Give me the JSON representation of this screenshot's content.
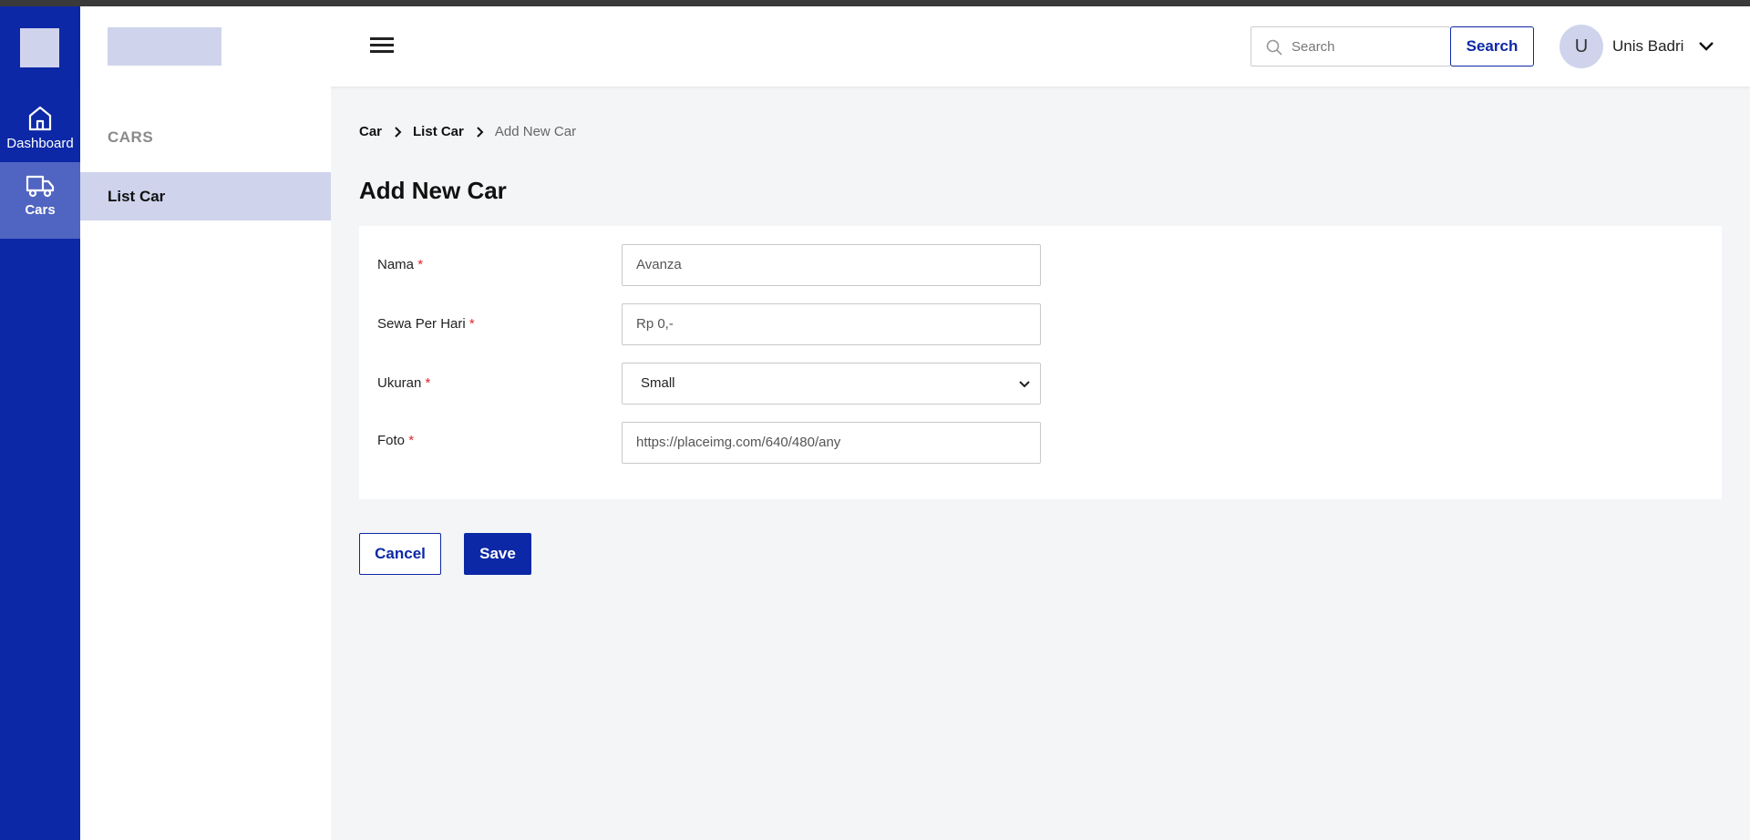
{
  "rail": {
    "items": [
      {
        "label": "Dashboard",
        "icon": "home-icon"
      },
      {
        "label": "Cars",
        "icon": "truck-icon",
        "active": true
      }
    ]
  },
  "header": {
    "search_placeholder": "Search",
    "search_button": "Search",
    "avatar_initial": "U",
    "user_name": "Unis Badri"
  },
  "subnav": {
    "title": "CARS",
    "items": [
      {
        "label": "List Car",
        "active": true
      }
    ]
  },
  "breadcrumb": {
    "items": [
      "Car",
      "List Car"
    ],
    "current": "Add New Car"
  },
  "page_title": "Add New Car",
  "form": {
    "fields": [
      {
        "label": "Nama",
        "required": "*",
        "placeholder": "Avanza"
      },
      {
        "label": "Sewa Per Hari",
        "required": "*",
        "placeholder": "Rp 0,-"
      },
      {
        "label": "Ukuran",
        "required": "*",
        "value": "Small"
      },
      {
        "label": "Foto",
        "required": "*",
        "placeholder": "https://placeimg.com/640/480/any"
      }
    ]
  },
  "actions": {
    "cancel": "Cancel",
    "save": "Save"
  },
  "colors": {
    "primary": "#0d28a6",
    "primary_light": "#cfd4ec",
    "rail_active": "#5065c1",
    "required": "#e0252b"
  }
}
